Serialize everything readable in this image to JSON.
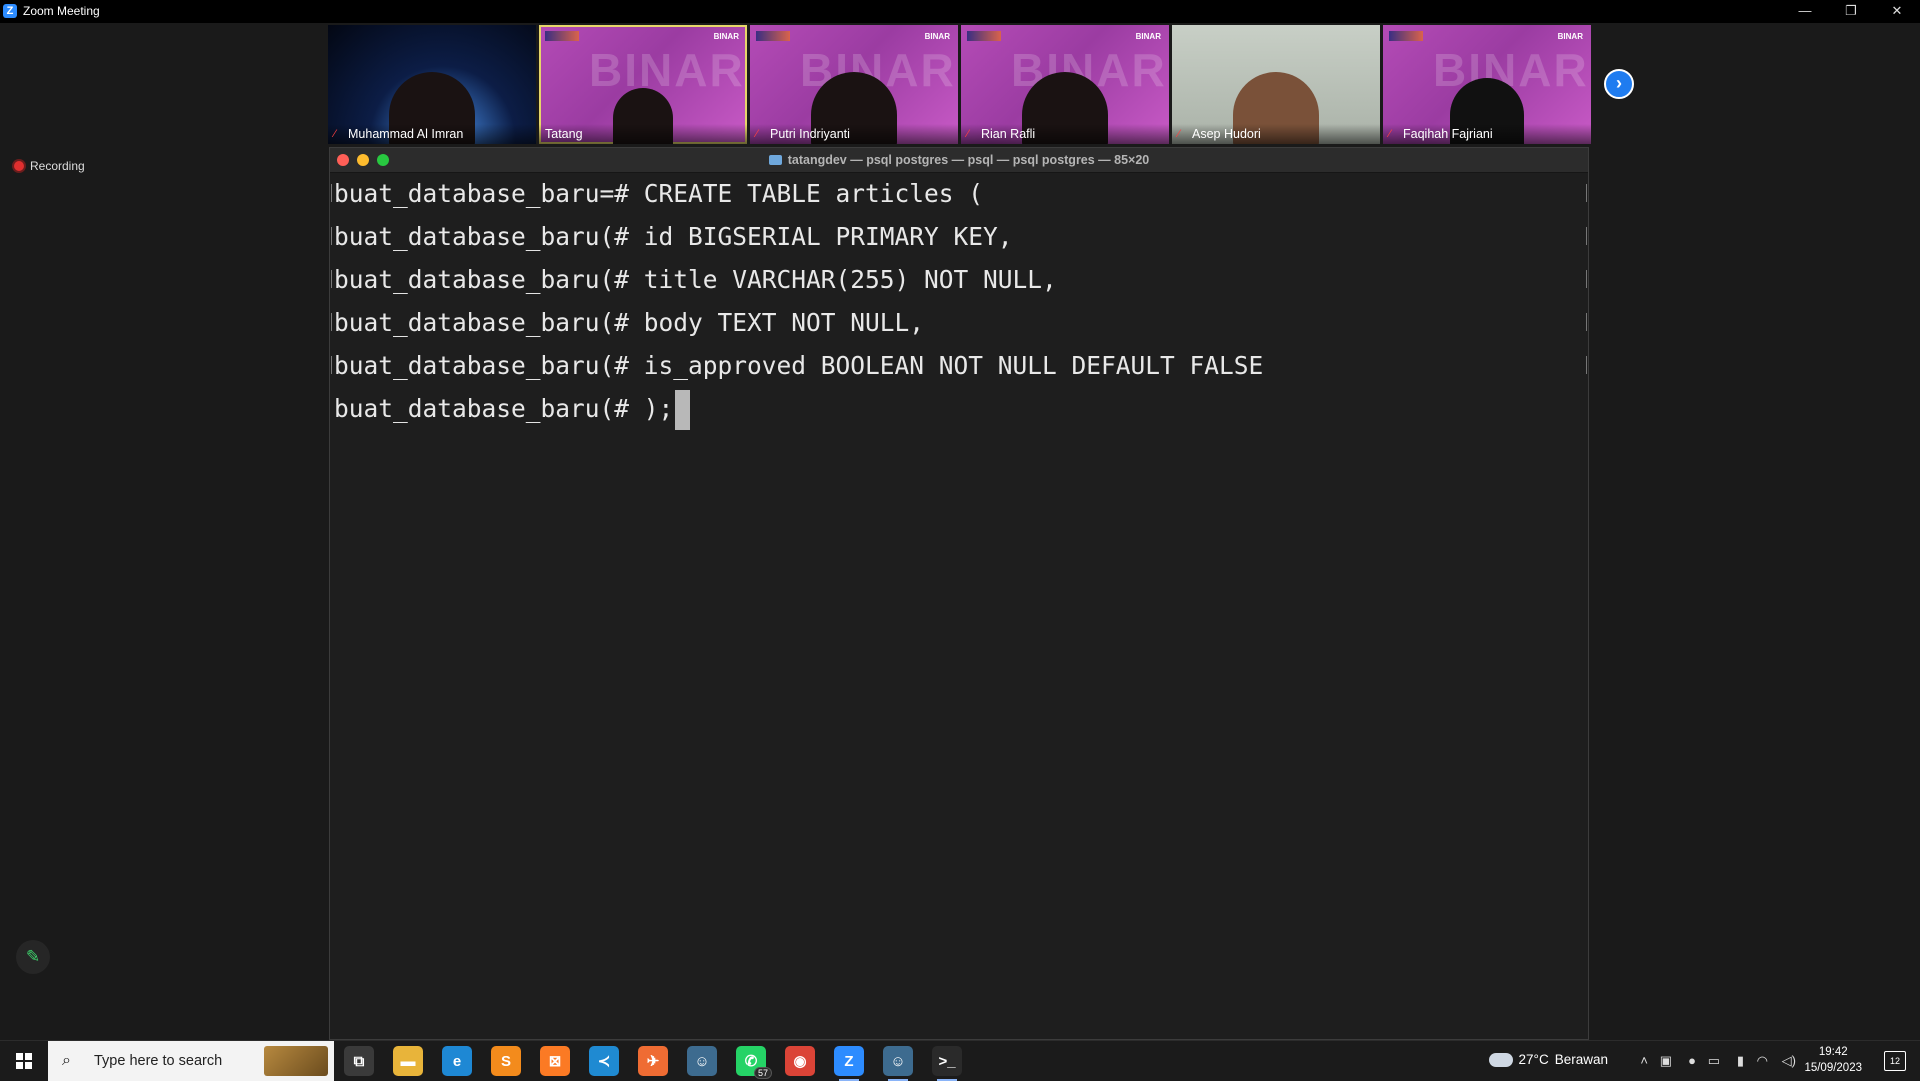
{
  "window": {
    "title": "Zoom Meeting",
    "logo_letter": "Z",
    "minimize_glyph": "—",
    "restore_glyph": "❐",
    "close_glyph": "✕"
  },
  "recording": {
    "label": "Recording",
    "color": "#e02f2f"
  },
  "participants": [
    {
      "name": "Muhammad Al Imran",
      "muted": true,
      "background": "space"
    },
    {
      "name": "Tatang",
      "muted": false,
      "background": "binar",
      "active_speaker": true
    },
    {
      "name": "Putri Indriyanti",
      "muted": true,
      "background": "binar"
    },
    {
      "name": "Rian Rafli",
      "muted": true,
      "background": "binar"
    },
    {
      "name": "Asep Hudori",
      "muted": true,
      "background": "room"
    },
    {
      "name": "Faqihah Fajriani",
      "muted": true,
      "background": "binar"
    }
  ],
  "binar_brand": "BINAR",
  "binar_watermark": "BINAR",
  "icons": {
    "mic_muted": "mic-muted-icon",
    "next": "chevron-right-icon",
    "pencil": "pencil-icon",
    "mic_glyph": "⁄",
    "next_glyph": "›",
    "pencil_glyph": "✎"
  },
  "terminal": {
    "title": "tatangdev — psql postgres — psql — psql postgres — 85×20",
    "lines": [
      "buat_database_baru=# CREATE TABLE articles (",
      "buat_database_baru(# id BIGSERIAL PRIMARY KEY,",
      "buat_database_baru(# title VARCHAR(255) NOT NULL,",
      "buat_database_baru(# body TEXT NOT NULL,",
      "buat_database_baru(# is_approved BOOLEAN NOT NULL DEFAULT FALSE",
      "buat_database_baru(# );"
    ],
    "traffic_colors": {
      "close": "#ff5f57",
      "minimize": "#febc2e",
      "zoom": "#28c840"
    }
  },
  "taskbar": {
    "search_placeholder": "Type here to search",
    "search_glyph": "⌕",
    "apps": [
      {
        "name": "task-view",
        "glyph": "⧉",
        "color": "#3a3a3a"
      },
      {
        "name": "file-explorer",
        "glyph": "▬",
        "color": "#e8b43a"
      },
      {
        "name": "edge",
        "glyph": "e",
        "color": "#1e88d4"
      },
      {
        "name": "sublime-text",
        "glyph": "S",
        "color": "#f38b1c"
      },
      {
        "name": "xampp",
        "glyph": "⊠",
        "color": "#fb7a24"
      },
      {
        "name": "vscode",
        "glyph": "≺",
        "color": "#1f8ad2"
      },
      {
        "name": "postman",
        "glyph": "✈",
        "color": "#ef6c33"
      },
      {
        "name": "postgres",
        "glyph": "☺",
        "color": "#3d6b8f"
      },
      {
        "name": "whatsapp",
        "glyph": "✆",
        "color": "#25d366",
        "badge": "57"
      },
      {
        "name": "chrome",
        "glyph": "◉",
        "color": "#db4437"
      },
      {
        "name": "zoom",
        "glyph": "Z",
        "color": "#2d8cff",
        "open": true
      },
      {
        "name": "postgres-2",
        "glyph": "☺",
        "color": "#3d6b8f",
        "open": true
      },
      {
        "name": "terminal",
        "glyph": ">_",
        "color": "#2a2a2a",
        "open": true
      }
    ],
    "weather": {
      "temp": "27°C",
      "condition": "Berawan"
    },
    "tray_glyphs": {
      "chevron": "˄",
      "meet": "▣",
      "mic": "●",
      "display": "▭",
      "battery": "▮",
      "wifi": "◠",
      "volume": "◁)"
    },
    "clock": {
      "time": "19:42",
      "date": "15/09/2023"
    },
    "notifications": "12"
  }
}
